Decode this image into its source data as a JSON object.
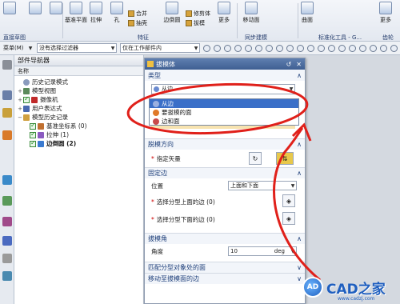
{
  "ribbon": {
    "buttons": [
      "基准平面",
      "拉伸",
      "孔",
      "边倒圆",
      "移动面",
      "曲面",
      "更多"
    ],
    "small_items": [
      "合并",
      "抽壳",
      "修剪体",
      "拔模"
    ],
    "more_label": "更多",
    "groups": [
      "直接草图",
      "特征",
      "同步建模",
      "标准化工具 - G...",
      "齿轮"
    ]
  },
  "filter_bar": {
    "menu": "菜单(M)",
    "filter": "没有选择过滤器",
    "scope": "仅在工作部件内"
  },
  "navigator": {
    "title": "部件导航器",
    "column": "名称",
    "items": [
      {
        "label": "历史记录模式"
      },
      {
        "label": "模型视图"
      },
      {
        "label": "摄像机"
      },
      {
        "label": "用户表达式"
      },
      {
        "label": "模型历史记录"
      },
      {
        "label": "基准坐标系 (0)"
      },
      {
        "label": "拉伸 (1)"
      },
      {
        "label": "边倒圆 (2)"
      }
    ]
  },
  "dialog": {
    "title": "拔模体",
    "type_section": "类型",
    "type_value": "从边",
    "direction_section": "脱模方向",
    "specify_vector": "指定矢量",
    "fixed_edge_section": "固定边",
    "position_label": "位置",
    "position_value": "上面和下面",
    "select_upper": "选择分型上面的边 (0)",
    "select_lower": "选择分型下面的边 (0)",
    "draft_angle_section": "拔模角",
    "angle_label": "角度",
    "angle_value": "10",
    "angle_unit": "deg",
    "match_section": "匹配分型对象处的面",
    "move_section": "移动至拔模面的边"
  },
  "popup": {
    "items": [
      "从边",
      "要拔模的面",
      "边和面"
    ],
    "selected_index": 0
  },
  "watermark": {
    "logo": "AD",
    "brand": "CAD之家",
    "url": "www.cadzj.com"
  },
  "colors": {
    "title_bar": "#4a6ca0",
    "selection": "#3a6fc8",
    "annotation": "#e0201a"
  }
}
